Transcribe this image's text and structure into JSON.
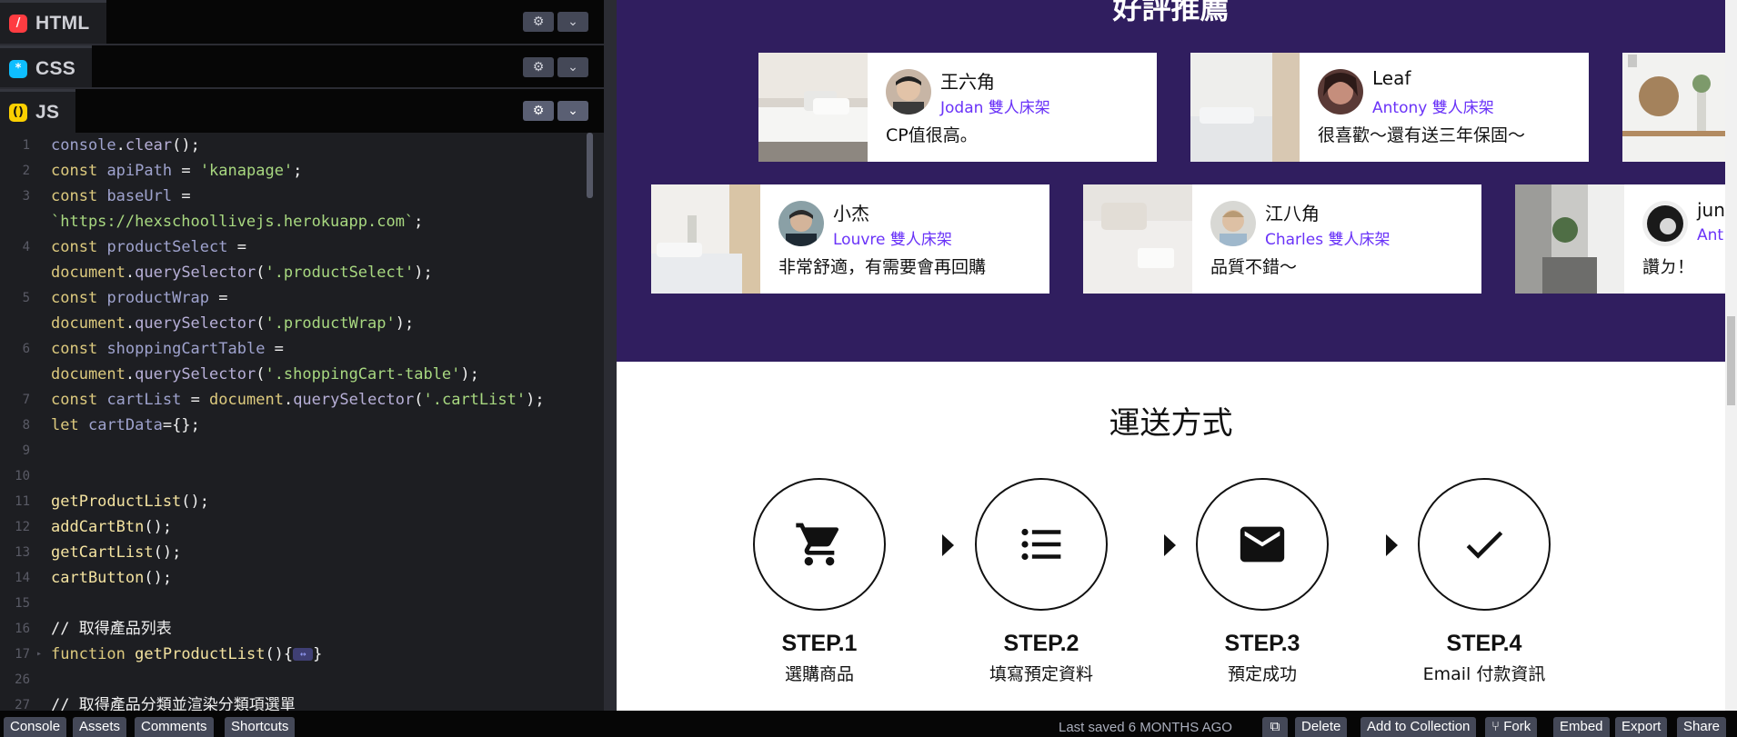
{
  "editor": {
    "panels": [
      {
        "name": "HTML",
        "icon": "html-icon",
        "color": "#ff3c41"
      },
      {
        "name": "CSS",
        "icon": "css-icon",
        "color": "#0ebeff"
      },
      {
        "name": "JS",
        "icon": "js-icon",
        "color": "#fcd000"
      }
    ],
    "code_lines": [
      {
        "num": "1",
        "text": "console.clear();"
      },
      {
        "num": "2",
        "text": "const apiPath = 'kanapage';"
      },
      {
        "num": "3",
        "text": "const baseUrl ="
      },
      {
        "num": "",
        "text": "`https://hexschoollivejs.herokuapp.com`;"
      },
      {
        "num": "4",
        "text": "const productSelect ="
      },
      {
        "num": "",
        "text": "document.querySelector('.productSelect');"
      },
      {
        "num": "5",
        "text": "const productWrap ="
      },
      {
        "num": "",
        "text": "document.querySelector('.productWrap');"
      },
      {
        "num": "6",
        "text": "const shoppingCartTable ="
      },
      {
        "num": "",
        "text": "document.querySelector('.shoppingCart-table');"
      },
      {
        "num": "7",
        "text": "const cartList = document.querySelector('.cartList');"
      },
      {
        "num": "8",
        "text": "let cartData={};"
      },
      {
        "num": "9",
        "text": ""
      },
      {
        "num": "10",
        "text": ""
      },
      {
        "num": "11",
        "text": "getProductList();"
      },
      {
        "num": "12",
        "text": "addCartBtn();"
      },
      {
        "num": "13",
        "text": "getCartList();"
      },
      {
        "num": "14",
        "text": "cartButton();"
      },
      {
        "num": "15",
        "text": ""
      },
      {
        "num": "16",
        "text": "// 取得產品列表"
      },
      {
        "num": "17",
        "text": "function getProductList(){↔}"
      },
      {
        "num": "26",
        "text": ""
      },
      {
        "num": "27",
        "text": "// 取得產品分類並渲染分類項選單"
      }
    ]
  },
  "preview": {
    "recommend_title": "好評推薦",
    "reviews": [
      {
        "name": "王六角",
        "product": "Jodan 雙人床架",
        "text": "CP值很高。"
      },
      {
        "name": "Leaf",
        "product": "Antony 雙人床架",
        "text": "很喜歡～還有送三年保固～"
      },
      {
        "name": "小杰",
        "product": "Louvre 雙人床架",
        "text": "非常舒適，有需要會再回購"
      },
      {
        "name": "江八角",
        "product": "Charles 雙人床架",
        "text": "品質不錯～"
      },
      {
        "name": "jun",
        "product": "Ant",
        "text": "讚ㄉ！"
      }
    ],
    "shipping_title": "運送方式",
    "steps": [
      {
        "label": "STEP.1",
        "desc": "選購商品",
        "icon": "cart-icon"
      },
      {
        "label": "STEP.2",
        "desc": "填寫預定資料",
        "icon": "list-icon"
      },
      {
        "label": "STEP.3",
        "desc": "預定成功",
        "icon": "mail-icon"
      },
      {
        "label": "STEP.4",
        "desc": "Email 付款資訊",
        "icon": "check-icon"
      }
    ]
  },
  "bottombar": {
    "left_buttons": [
      "Console",
      "Assets",
      "Comments",
      "Shortcuts"
    ],
    "last_saved_prefix": "Last saved",
    "last_saved_ago": "6 MONTHS AGO",
    "right_buttons": [
      "Delete",
      "Add to Collection",
      "Fork",
      "Embed",
      "Export",
      "Share"
    ]
  }
}
